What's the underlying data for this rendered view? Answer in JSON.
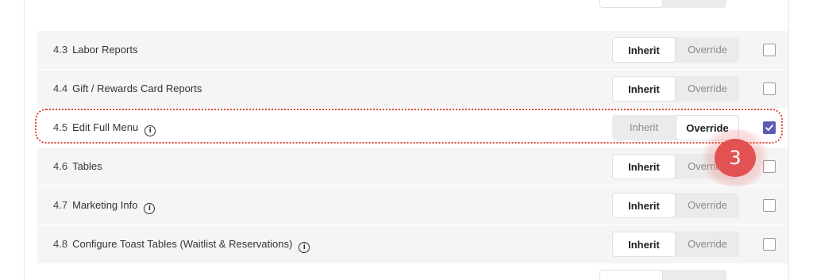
{
  "rows": [
    {
      "num": "4.3",
      "label": "Labor Reports",
      "info": false,
      "mode": "inherit",
      "checked": false
    },
    {
      "num": "4.4",
      "label": "Gift / Rewards Card Reports",
      "info": false,
      "mode": "inherit",
      "checked": false
    },
    {
      "num": "4.5",
      "label": "Edit Full Menu",
      "info": true,
      "mode": "override",
      "checked": true
    },
    {
      "num": "4.6",
      "label": "Tables",
      "info": false,
      "mode": "inherit",
      "checked": false
    },
    {
      "num": "4.7",
      "label": "Marketing Info",
      "info": true,
      "mode": "inherit",
      "checked": false
    },
    {
      "num": "4.8",
      "label": "Configure Toast Tables (Waitlist & Reservations)",
      "info": true,
      "mode": "inherit",
      "checked": false
    }
  ],
  "toggle": {
    "inherit_label": "Inherit",
    "override_label": "Override"
  },
  "info_glyph": "i",
  "callout": {
    "number": "3"
  },
  "colors": {
    "checkbox_checked": "#5b5bb5",
    "highlight": "#e0443c",
    "callout": "#e25252"
  }
}
